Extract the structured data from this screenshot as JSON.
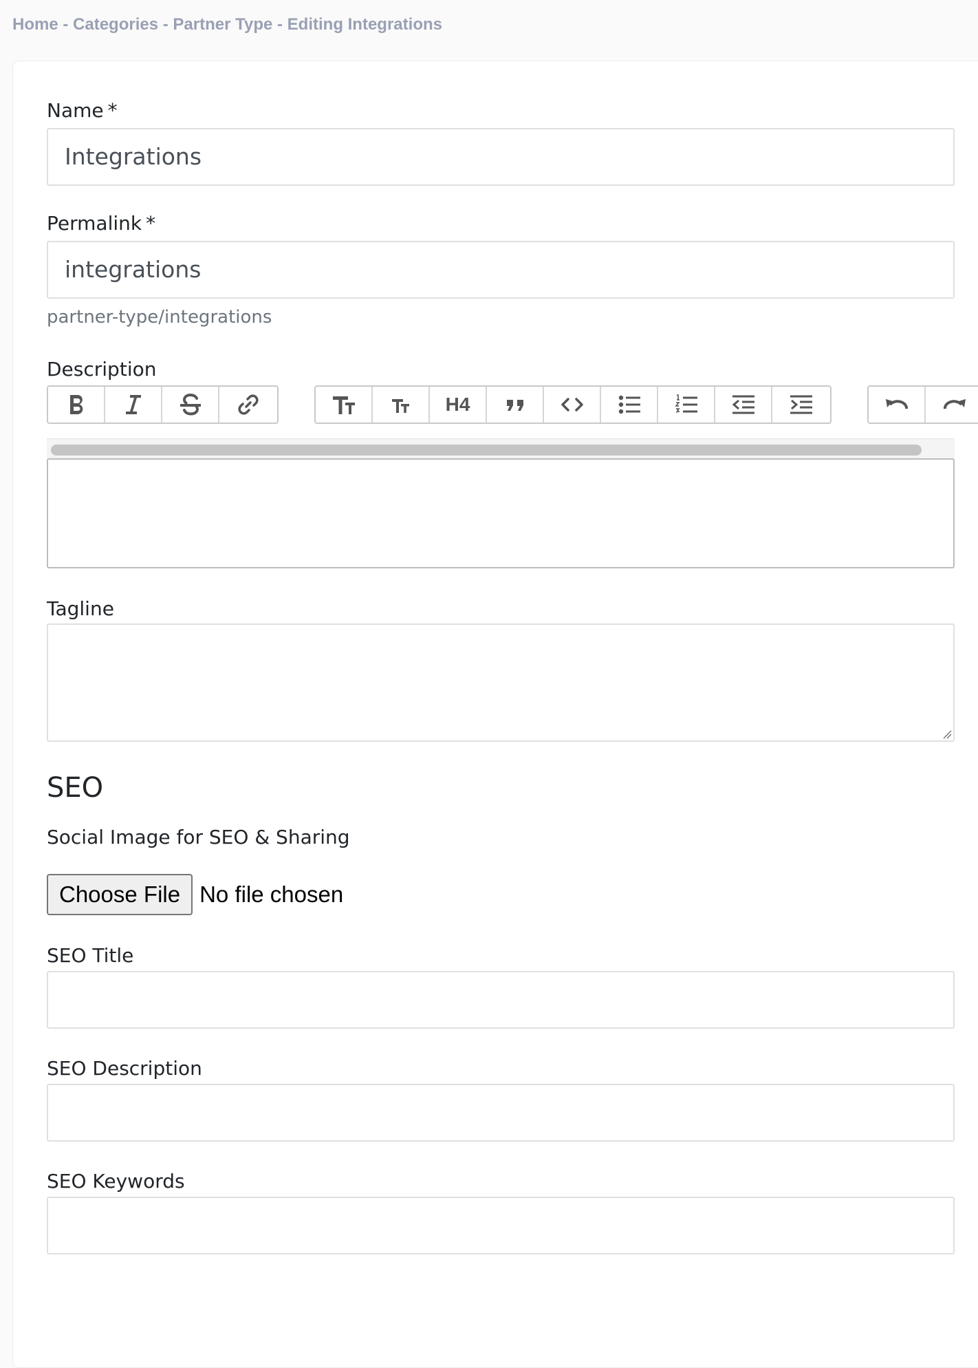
{
  "breadcrumb": {
    "items": [
      "Home",
      "Categories",
      "Partner Type",
      "Editing Integrations"
    ],
    "separator": " - "
  },
  "form": {
    "name": {
      "label": "Name",
      "required_mark": "*",
      "value": "Integrations"
    },
    "permalink": {
      "label": "Permalink",
      "required_mark": "*",
      "value": "integrations",
      "help": "partner-type/integrations"
    },
    "description": {
      "label": "Description",
      "toolbar": {
        "group1": [
          "bold-icon",
          "italic-icon",
          "strikethrough-icon",
          "link-icon"
        ],
        "group2": [
          "heading-large-icon",
          "heading-small-icon",
          "H4",
          "quote-icon",
          "code-icon",
          "bullet-list-icon",
          "numbered-list-icon",
          "outdent-icon",
          "indent-icon"
        ],
        "group3": [
          "undo-icon",
          "redo-icon"
        ]
      },
      "value": ""
    },
    "tagline": {
      "label": "Tagline",
      "value": ""
    },
    "seo": {
      "heading": "SEO",
      "social_image": {
        "label": "Social Image for SEO & Sharing",
        "button": "Choose File",
        "status": "No file chosen"
      },
      "title": {
        "label": "SEO Title",
        "value": ""
      },
      "description": {
        "label": "SEO Description",
        "value": ""
      },
      "keywords": {
        "label": "SEO Keywords",
        "value": ""
      }
    }
  },
  "colors": {
    "breadcrumb": "#9aa0b4",
    "border": "#e0e0e0",
    "text": "#212529",
    "toolbar_icon": "#555555"
  }
}
